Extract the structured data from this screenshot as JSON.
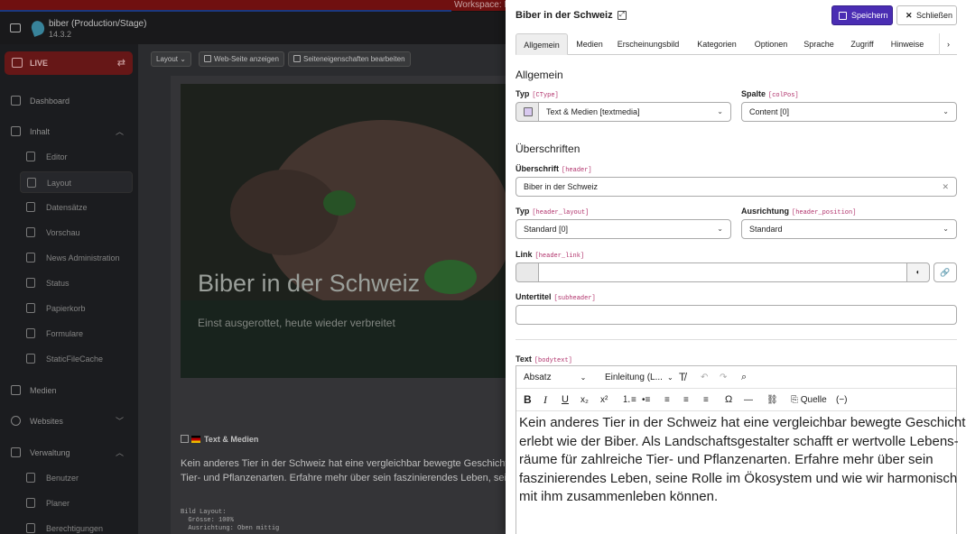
{
  "workspace_bar": {
    "text": "Workspace: LIVE"
  },
  "topbar": {
    "site_name": "biber (Production/Stage)",
    "version": "14.3.2"
  },
  "sidebar": {
    "live_label": "LIVE",
    "items": [
      {
        "label": "Dashboard"
      },
      {
        "label": "Inhalt"
      },
      {
        "label": "Medien"
      },
      {
        "label": "Websites"
      },
      {
        "label": "Verwaltung"
      }
    ],
    "sub_inhalt": [
      "Editor",
      "Layout",
      "Datensätze",
      "Vorschau",
      "News Administration",
      "Status",
      "Papierkorb",
      "Formulare",
      "StaticFileCache"
    ],
    "sub_verwaltung": [
      "Benutzer",
      "Planer",
      "Berechtigungen"
    ]
  },
  "content_toolbar": {
    "layout_select": "Layout",
    "view_page": "Web-Seite anzeigen",
    "edit_page_props": "Seiteneigenschaften bearbeiten"
  },
  "hero": {
    "title": "Biber in der Schweiz",
    "subtitle": "Einst ausgerottet, heute wieder verbreitet"
  },
  "content_card": {
    "type_label": "Text & Medien",
    "text": "Kein anderes Tier in der Schweiz hat eine vergleichbar bewegte Geschichte erlebt wie der Biber.\nTier- und Pflanzenarten. Erfahre mehr über sein faszinierendes Leben, seine Rolle im Ökosystem",
    "meta": "Bild Layout:\n  Grösse: 100%\n  Ausrichtung: Oben mittig"
  },
  "panel": {
    "title": "Biber in der Schweiz",
    "save": "Speichern",
    "close": "Schließen",
    "tabs": [
      "Allgemein",
      "Medien",
      "Erscheinungsbild",
      "Kategorien",
      "Optionen",
      "Sprache",
      "Zugriff",
      "Hinweise"
    ],
    "section_general": "Allgemein",
    "section_headers": "Überschriften",
    "fields": {
      "ctype_label": "Typ",
      "ctype_code": "[CType]",
      "ctype_value": "Text & Medien [textmedia]",
      "colpos_label": "Spalte",
      "colpos_code": "[colPos]",
      "colpos_value": "Content [0]",
      "header_label": "Überschrift",
      "header_code": "[header]",
      "header_value": "Biber in der Schweiz",
      "header_layout_label": "Typ",
      "header_layout_code": "[header_layout]",
      "header_layout_value": "Standard [0]",
      "header_position_label": "Ausrichtung",
      "header_position_code": "[header_position]",
      "header_position_value": "Standard",
      "header_link_label": "Link",
      "header_link_code": "[header_link]",
      "header_link_value": "",
      "subheader_label": "Untertitel",
      "subheader_code": "[subheader]",
      "subheader_value": "",
      "bodytext_label": "Text",
      "bodytext_code": "[bodytext]"
    },
    "rte": {
      "paragraph_style": "Absatz",
      "heading_style": "Einleitung (L...",
      "source": "Quelle",
      "body": "Kein anderes Tier in der Schweiz hat eine vergleichbar bewegte Geschichte\nerlebt wie der Biber. Als Landschaftsgestalter schafft er wertvolle Lebens-\nräume für zahlreiche Tier- und Pflanzenarten. Erfahre mehr über sein\nfaszinierendes Leben, seine Rolle im Ökosystem und wie wir harmonisch\nmit ihm zusammenleben können."
    }
  },
  "colors": {
    "primary": "#4a2db3",
    "live_bg": "#6f1a1a",
    "workspace_bar": "#7a1212",
    "code": "#b0306a"
  }
}
